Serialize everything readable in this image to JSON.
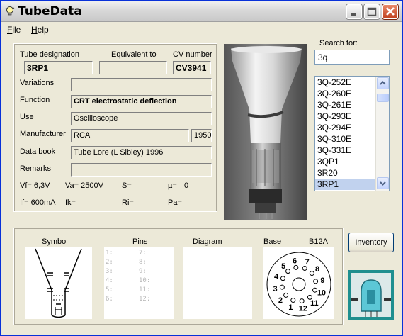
{
  "window": {
    "title": "TubeData"
  },
  "menu": [
    {
      "label": "File",
      "key": "F",
      "rest": "ile"
    },
    {
      "label": "Help",
      "key": "H",
      "rest": "elp"
    }
  ],
  "tube": {
    "designation_label": "Tube designation",
    "equivalent_label": "Equivalent to",
    "cv_label": "CV number",
    "designation": "3RP1",
    "equivalent": "",
    "cv": "CV3941",
    "variations_label": "Variations",
    "variations": "",
    "function_label": "Function",
    "function": "CRT electrostatic deflection",
    "use_label": "Use",
    "use": "Oscilloscope",
    "manufacturer_label": "Manufacturer",
    "manufacturer": "RCA",
    "year": "1950",
    "databook_label": "Data book",
    "databook": "Tube Lore (L Sibley) 1996",
    "remarks_label": "Remarks",
    "remarks": "",
    "vf": "Vf= 6,3V",
    "va": "Va= 2500V",
    "s": "S=",
    "mu": "µ=",
    "mu_value": "0",
    "if": "If= 600mA",
    "ik": "Ik=",
    "ri": "Ri=",
    "pa": "Pa="
  },
  "search": {
    "label": "Search for:",
    "value": "3q",
    "results": [
      "3Q-252E",
      "3Q-260E",
      "3Q-261E",
      "3Q-293E",
      "3Q-294E",
      "3Q-310E",
      "3Q-331E",
      "3QP1",
      "3R20",
      "3RP1"
    ],
    "selected_index": 9
  },
  "bottom": {
    "symbol_label": "Symbol",
    "pins_label": "Pins",
    "diagram_label": "Diagram",
    "base_label": "Base",
    "base_type": "B12A",
    "pins_left": [
      "1:",
      "2:",
      "3:",
      "4:",
      "5:",
      "6:"
    ],
    "pins_right": [
      "7:",
      "8:",
      "9:",
      "10:",
      "11:",
      "12:"
    ],
    "base_numbers": [
      "1",
      "2",
      "3",
      "4",
      "5",
      "6",
      "7",
      "8",
      "9",
      "10",
      "11",
      "12"
    ]
  },
  "buttons": {
    "inventory": "Inventory"
  },
  "colors": {
    "title_bar": "#d9d9d9",
    "close_button": "#c1401e",
    "selection": "#c1d2ee"
  },
  "icons": [
    "bulb-icon",
    "minimize-icon",
    "maximize-icon",
    "close-icon",
    "scroll-up-icon",
    "scroll-down-icon"
  ]
}
